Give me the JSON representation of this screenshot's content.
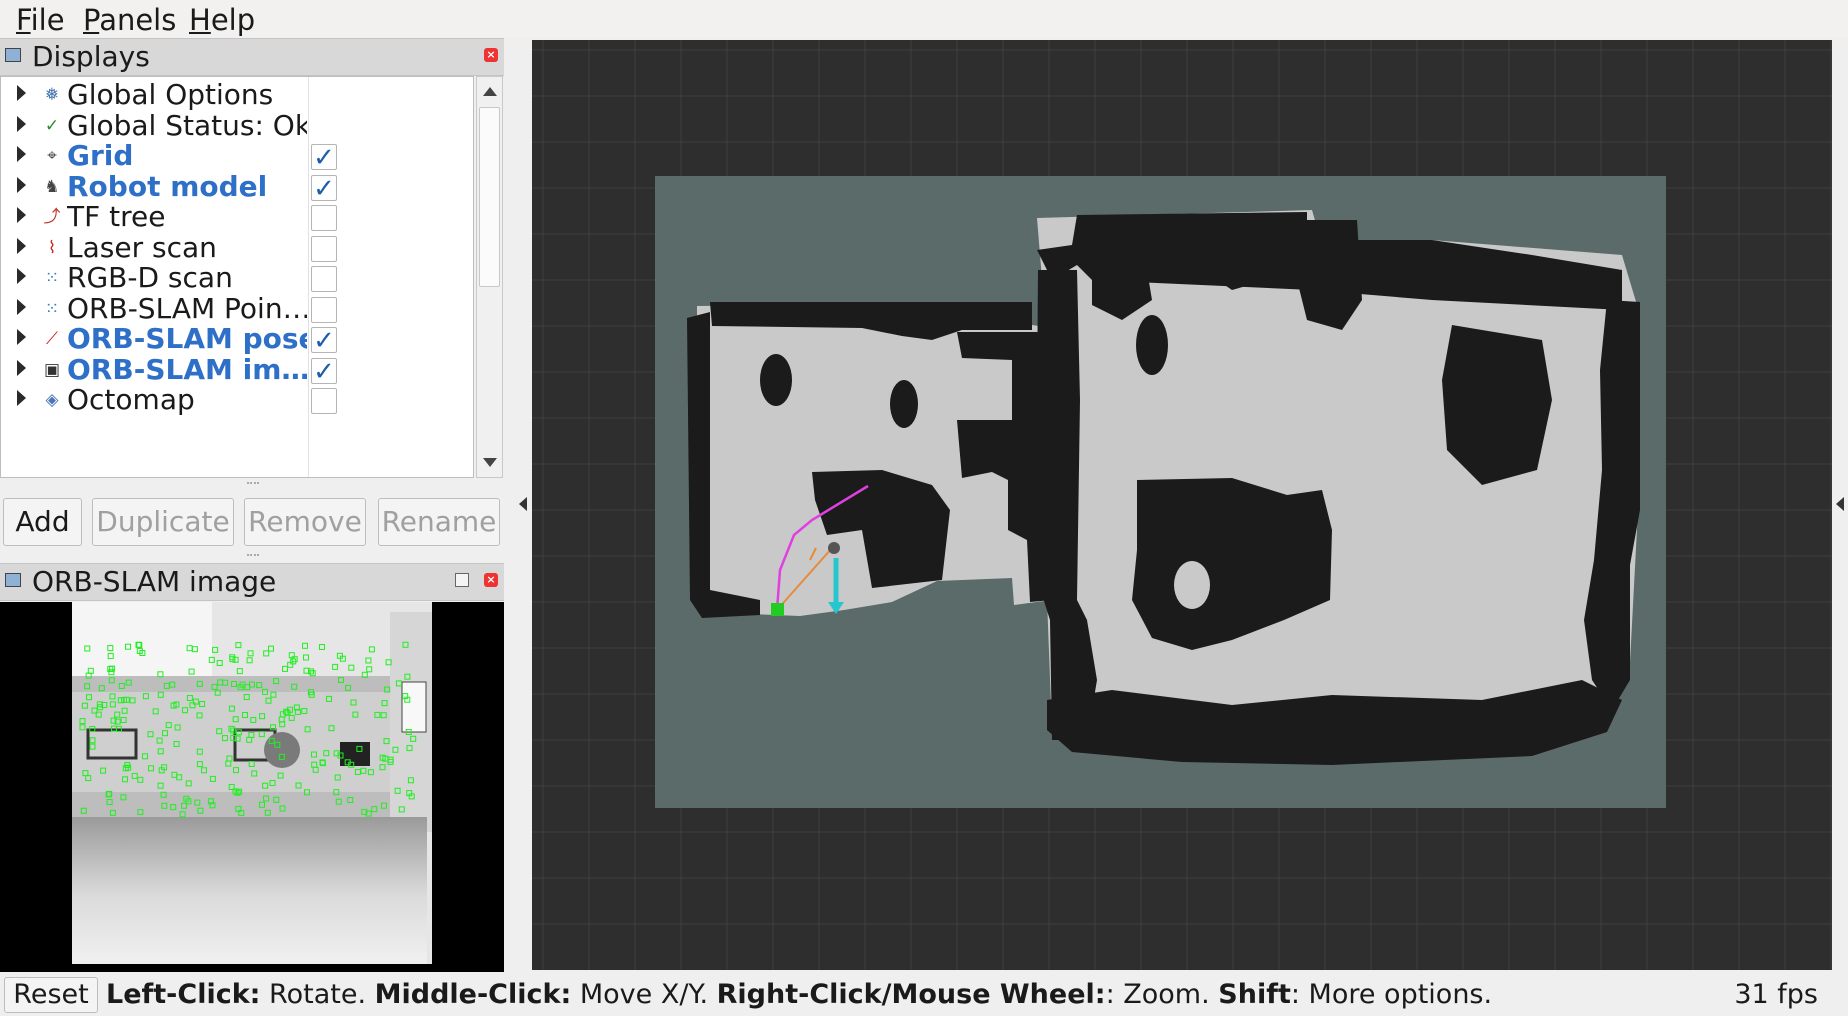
{
  "menu": [
    "File",
    "Panels",
    "Help"
  ],
  "displays_panel": {
    "title": "Displays",
    "items": [
      {
        "label": "Global Options",
        "icon": "gear-icon",
        "icon_glyph": "❅",
        "icon_color": "#4a77b4",
        "checkbox": false,
        "enabled": false
      },
      {
        "label": "Global Status: Ok",
        "icon": "check-icon",
        "icon_glyph": "✓",
        "icon_color": "#2b8a2b",
        "checkbox": false,
        "enabled": false
      },
      {
        "label": "Grid",
        "icon": "grid-icon",
        "icon_glyph": "⌖",
        "icon_color": "#444444",
        "checkbox": true,
        "enabled": true
      },
      {
        "label": "Robot model",
        "icon": "robot-icon",
        "icon_glyph": "♞",
        "icon_color": "#444444",
        "checkbox": true,
        "enabled": true
      },
      {
        "label": "TF tree",
        "icon": "axes-icon",
        "icon_glyph": "⤴",
        "icon_color": "#c0392b",
        "checkbox": true,
        "enabled": false
      },
      {
        "label": "Laser scan",
        "icon": "laser-icon",
        "icon_glyph": "⌇",
        "icon_color": "#cc2222",
        "checkbox": true,
        "enabled": false
      },
      {
        "label": "RGB-D scan",
        "icon": "pointcloud-icon",
        "icon_glyph": "⁙",
        "icon_color": "#3a7bbf",
        "checkbox": true,
        "enabled": false
      },
      {
        "label": "ORB-SLAM Poin…",
        "icon": "pointcloud-icon",
        "icon_glyph": "⁙",
        "icon_color": "#3a7bbf",
        "checkbox": true,
        "enabled": false
      },
      {
        "label": "ORB-SLAM pose",
        "icon": "pose-arrow-icon",
        "icon_glyph": "⟋",
        "icon_color": "#dd1111",
        "checkbox": true,
        "enabled": true
      },
      {
        "label": "ORB-SLAM im…",
        "icon": "image-icon",
        "icon_glyph": "▣",
        "icon_color": "#333333",
        "checkbox": true,
        "enabled": true
      },
      {
        "label": "Octomap",
        "icon": "octomap-icon",
        "icon_glyph": "◈",
        "icon_color": "#4a77b4",
        "checkbox": true,
        "enabled": false
      }
    ]
  },
  "buttons": {
    "add": "Add",
    "duplicate": "Duplicate",
    "remove": "Remove",
    "rename": "Rename"
  },
  "image_panel": {
    "title": "ORB-SLAM image"
  },
  "status": {
    "reset": "Reset",
    "help": [
      {
        "key": "Left-Click:",
        "text": " Rotate. "
      },
      {
        "key": "Middle-Click:",
        "text": " Move X/Y. "
      },
      {
        "key": "Right-Click/Mouse Wheel:",
        "text": ": Zoom. "
      },
      {
        "key": "Shift",
        "text": ": More options."
      }
    ],
    "fps": "31 fps"
  },
  "colors": {
    "viewport_bg": "#2e2e2e",
    "grid_line": "#3f3f3f",
    "map_unknown": "#5a6b69",
    "map_free": "#c9c9c9",
    "map_occupied": "#1b1b1b",
    "trajectory": "#e040e0",
    "pose_arrow": "#26c6cf",
    "keyframe": "#22cc22",
    "feature": "#22ee22",
    "checked": "#2e70c8"
  }
}
